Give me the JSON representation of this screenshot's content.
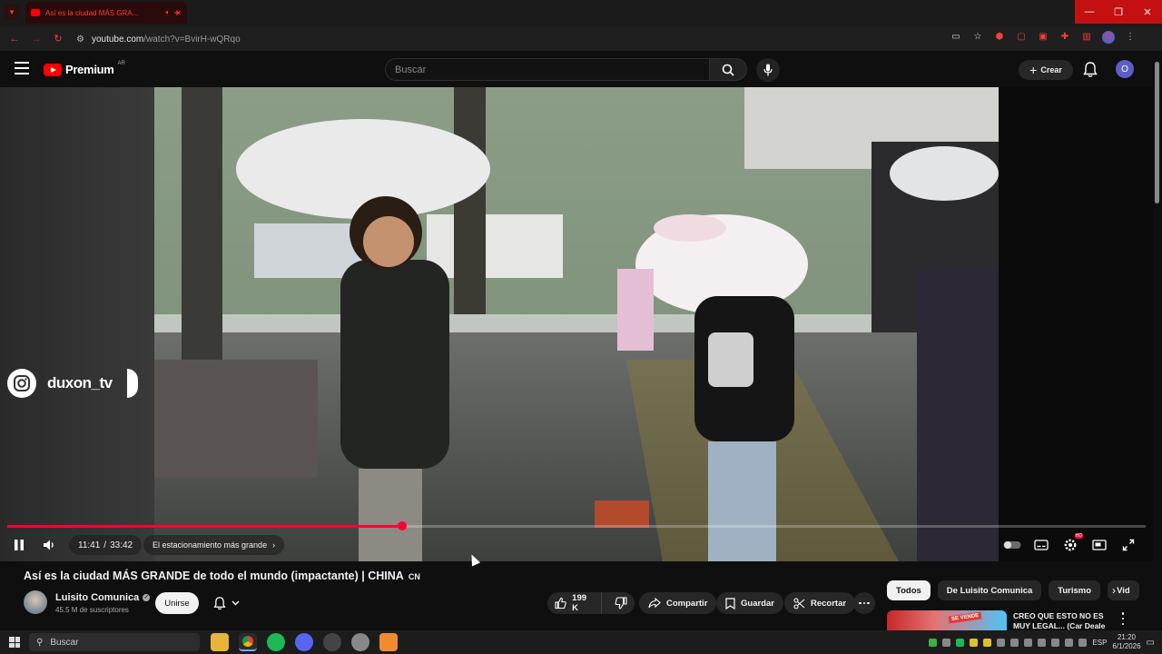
{
  "browser": {
    "tab_title": "Así es la ciudad MÁS GRA...",
    "url_host": "youtube.com",
    "url_path": "/watch?v=BvirH-wQRqo"
  },
  "header": {
    "logo_word": "Premium",
    "region": "AR",
    "search_placeholder": "Buscar",
    "create_label": "Crear",
    "avatar_initial": "O"
  },
  "player": {
    "overlay_handle": "duxon_tv",
    "time_current": "11:41",
    "time_separator": "/",
    "time_total": "33:42",
    "chapter": "El estacionamiento más grande",
    "progress": 0.347,
    "hd_badge": "HD"
  },
  "video": {
    "title": "Así es la ciudad MÁS GRANDE de todo el mundo (impactante) | CHINA",
    "title_flag": "CN",
    "channel_name": "Luisito Comunica",
    "subscribers": "45.5 M de suscriptores",
    "join_label": "Unirse",
    "likes": "199 K",
    "share_label": "Compartir",
    "save_label": "Guardar",
    "clip_label": "Recortar"
  },
  "chips": [
    "Todos",
    "De Luisito Comunica",
    "Turismo",
    "Vid"
  ],
  "recommendation": {
    "title": "CREO QUE ESTO NO ES MUY LEGAL... (Car Deale",
    "thumb_text": "SE VENDE"
  },
  "taskbar": {
    "search_label": "Buscar",
    "language": "ESP",
    "time": "21:20",
    "date": "6/1/2026"
  },
  "colors": {
    "brand_red": "#ff0000",
    "progress_red": "#ff0033",
    "background": "#0f0f0f"
  }
}
